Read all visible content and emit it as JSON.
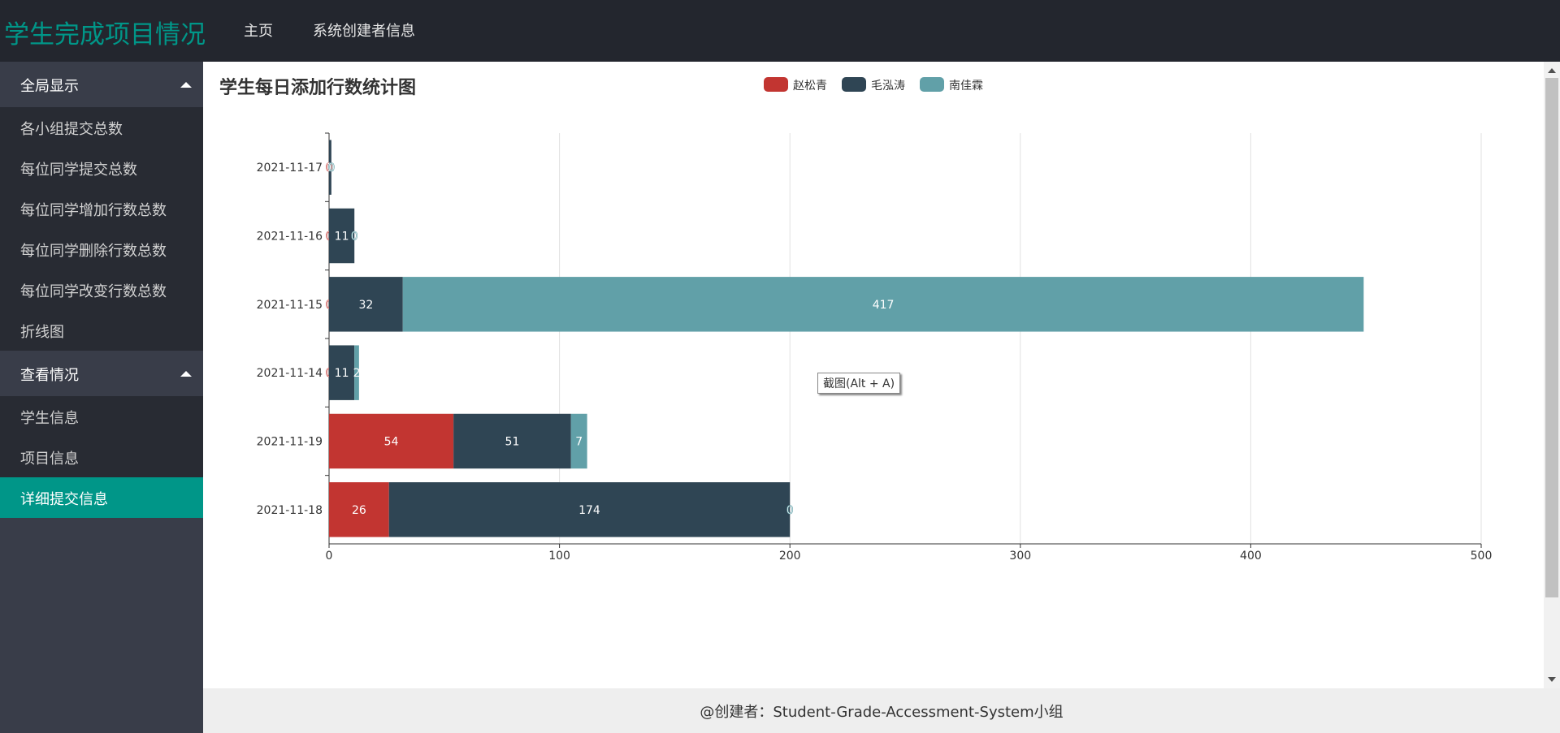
{
  "header": {
    "app_title": "学生完成项目情况",
    "nav": [
      "主页",
      "系统创建者信息"
    ]
  },
  "sidebar": {
    "groups": [
      {
        "title": "全局显示",
        "items": [
          "各小组提交总数",
          "每位同学提交总数",
          "每位同学增加行数总数",
          "每位同学删除行数总数",
          "每位同学改变行数总数",
          "折线图"
        ]
      },
      {
        "title": "查看情况",
        "items": [
          "学生信息",
          "项目信息",
          "详细提交信息"
        ]
      }
    ],
    "active_item": "详细提交信息"
  },
  "tooltip": {
    "text": "截图(Alt + A)"
  },
  "footer": {
    "text": "@创建者：Student-Grade-Accessment-System小组"
  },
  "colors": {
    "brand": "#009688",
    "topbar": "#23262e",
    "sidebar": "#393d49"
  },
  "chart_data": {
    "type": "bar",
    "orientation": "horizontal",
    "stacked": true,
    "title": "学生每日添加行数统计图",
    "categories": [
      "2021-11-17",
      "2021-11-16",
      "2021-11-15",
      "2021-11-14",
      "2021-11-19",
      "2021-11-18"
    ],
    "series": [
      {
        "name": "赵松青",
        "color": "#c23531",
        "values": [
          0,
          0,
          0,
          0,
          54,
          26
        ]
      },
      {
        "name": "毛泓涛",
        "color": "#2f4554",
        "values": [
          1,
          11,
          32,
          11,
          51,
          174
        ]
      },
      {
        "name": "南佳霖",
        "color": "#61a0a8",
        "values": [
          0,
          0,
          417,
          2,
          7,
          0
        ]
      }
    ],
    "xlim": [
      0,
      500
    ],
    "xticks": [
      0,
      100,
      200,
      300,
      400,
      500
    ],
    "grid": true,
    "legend_position": "top-center",
    "data_labels": true
  }
}
